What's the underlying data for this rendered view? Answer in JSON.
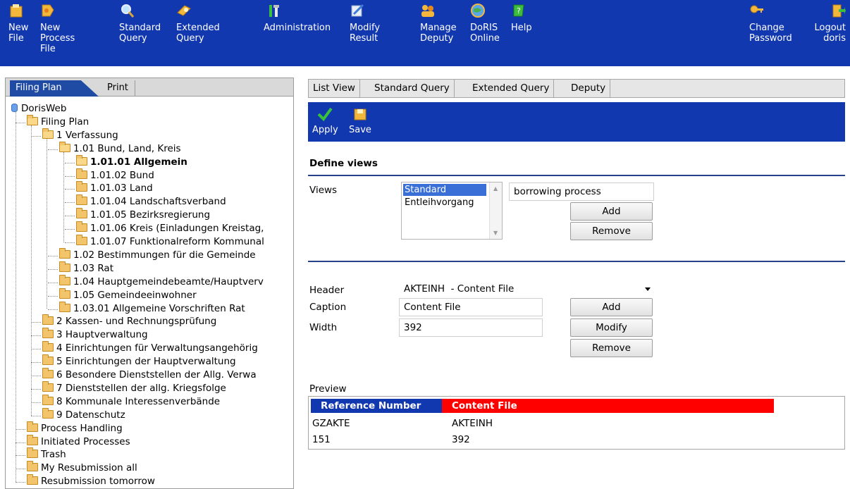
{
  "toolbar": {
    "items": [
      {
        "label": "New\nFile",
        "icon": "new-file-icon"
      },
      {
        "label": "New\nProcess\nFile",
        "icon": "new-process-file-icon"
      },
      {
        "label": "Standard\nQuery",
        "icon": "magnifier-icon"
      },
      {
        "label": "Extended\nQuery",
        "icon": "extended-query-icon"
      },
      {
        "label": "Administration",
        "icon": "tools-icon"
      },
      {
        "label": "Modify\nResult",
        "icon": "modify-result-icon"
      },
      {
        "label": "Manage\nDeputy",
        "icon": "people-icon"
      },
      {
        "label": "DoRIS\nOnline",
        "icon": "globe-icon"
      },
      {
        "label": "Help",
        "icon": "help-icon"
      },
      {
        "label": "Change\nPassword",
        "icon": "key-icon"
      },
      {
        "label": "Logout\ndoris",
        "icon": "logout-icon"
      }
    ]
  },
  "left_tabs": {
    "filing_plan": "Filing Plan",
    "print": "Print"
  },
  "tree": [
    "DorisWeb",
    "Filing Plan",
    "1 Verfassung",
    "1.01 Bund, Land, Kreis",
    "1.01.01 Allgemein",
    "1.01.02 Bund",
    "1.01.03 Land",
    "1.01.04 Landschaftsverband",
    "1.01.05 Bezirksregierung",
    "1.01.06 Kreis (Einladungen Kreistag,",
    "1.01.07 Funktionalreform Kommunal",
    "1.02 Bestimmungen für die Gemeinde",
    "1.03 Rat",
    "1.04 Hauptgemeindebeamte/Hauptverv",
    "1.05 Gemeindeeinwohner",
    "1.03.01 Allgemeine Vorschriften Rat",
    "2 Kassen- und Rechnungsprüfung",
    "3 Hauptverwaltung",
    "4 Einrichtungen für Verwaltungsangehörig",
    "5 Einrichtungen der Hauptverwaltung",
    "6 Besondere Dienststellen der Allg. Verwa",
    "7 Dienststellen der allg. Kriegsfolge",
    "8 Kommunale Interessenverbände",
    "9 Datenschutz",
    "Process Handling",
    "Initiated Processes",
    "Trash",
    "My Resubmission all",
    "Resubmission tomorrow"
  ],
  "right_tabs": [
    "List View",
    "Standard Query",
    "Extended Query",
    "Deputy"
  ],
  "actions": {
    "apply": "Apply",
    "save": "Save"
  },
  "define_views": {
    "title": "Define views",
    "views_label": "Views",
    "views_options": [
      "Standard",
      "Entleihvorgang"
    ],
    "selected_view": "Standard",
    "new_view_value": "borrowing process",
    "add": "Add",
    "remove": "Remove"
  },
  "columns": {
    "header_label": "Header",
    "header_value": "AKTEINH  - Content File",
    "caption_label": "Caption",
    "caption_value": "Content File",
    "width_label": "Width",
    "width_value": "392",
    "add": "Add",
    "modify": "Modify",
    "remove": "Remove"
  },
  "preview": {
    "label": "Preview",
    "headers": [
      "Reference Number",
      "Content File"
    ],
    "rows": [
      [
        "GZAKTE",
        "AKTEINH"
      ],
      [
        "151",
        "392"
      ]
    ],
    "colors": {
      "ref_header": "#1238b0",
      "content_header": "#ff0000"
    }
  },
  "colors": {
    "brand_blue": "#1238b0"
  }
}
